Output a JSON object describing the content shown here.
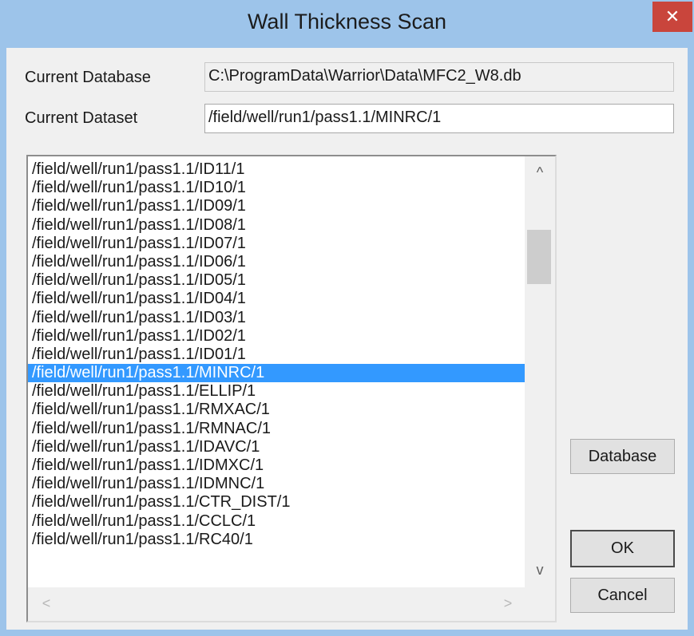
{
  "window": {
    "title": "Wall Thickness Scan",
    "close_symbol": "✕"
  },
  "form": {
    "database_label": "Current Database",
    "database_value": "C:\\ProgramData\\Warrior\\Data\\MFC2_W8.db",
    "dataset_label": "Current Dataset",
    "dataset_value": "/field/well/run1/pass1.1/MINRC/1"
  },
  "list": {
    "items": [
      "/field/well/run1/pass1.1/ID11/1",
      "/field/well/run1/pass1.1/ID10/1",
      "/field/well/run1/pass1.1/ID09/1",
      "/field/well/run1/pass1.1/ID08/1",
      "/field/well/run1/pass1.1/ID07/1",
      "/field/well/run1/pass1.1/ID06/1",
      "/field/well/run1/pass1.1/ID05/1",
      "/field/well/run1/pass1.1/ID04/1",
      "/field/well/run1/pass1.1/ID03/1",
      "/field/well/run1/pass1.1/ID02/1",
      "/field/well/run1/pass1.1/ID01/1",
      "/field/well/run1/pass1.1/MINRC/1",
      "/field/well/run1/pass1.1/ELLIP/1",
      "/field/well/run1/pass1.1/RMXAC/1",
      "/field/well/run1/pass1.1/RMNAC/1",
      "/field/well/run1/pass1.1/IDAVC/1",
      "/field/well/run1/pass1.1/IDMXC/1",
      "/field/well/run1/pass1.1/IDMNC/1",
      "/field/well/run1/pass1.1/CTR_DIST/1",
      "/field/well/run1/pass1.1/CCLC/1",
      "/field/well/run1/pass1.1/RC40/1"
    ],
    "selected_index": 11,
    "arrow_up": "^",
    "arrow_down": "v",
    "arrow_left": "<",
    "arrow_right": ">"
  },
  "buttons": {
    "database": "Database",
    "ok": "OK",
    "cancel": "Cancel"
  }
}
